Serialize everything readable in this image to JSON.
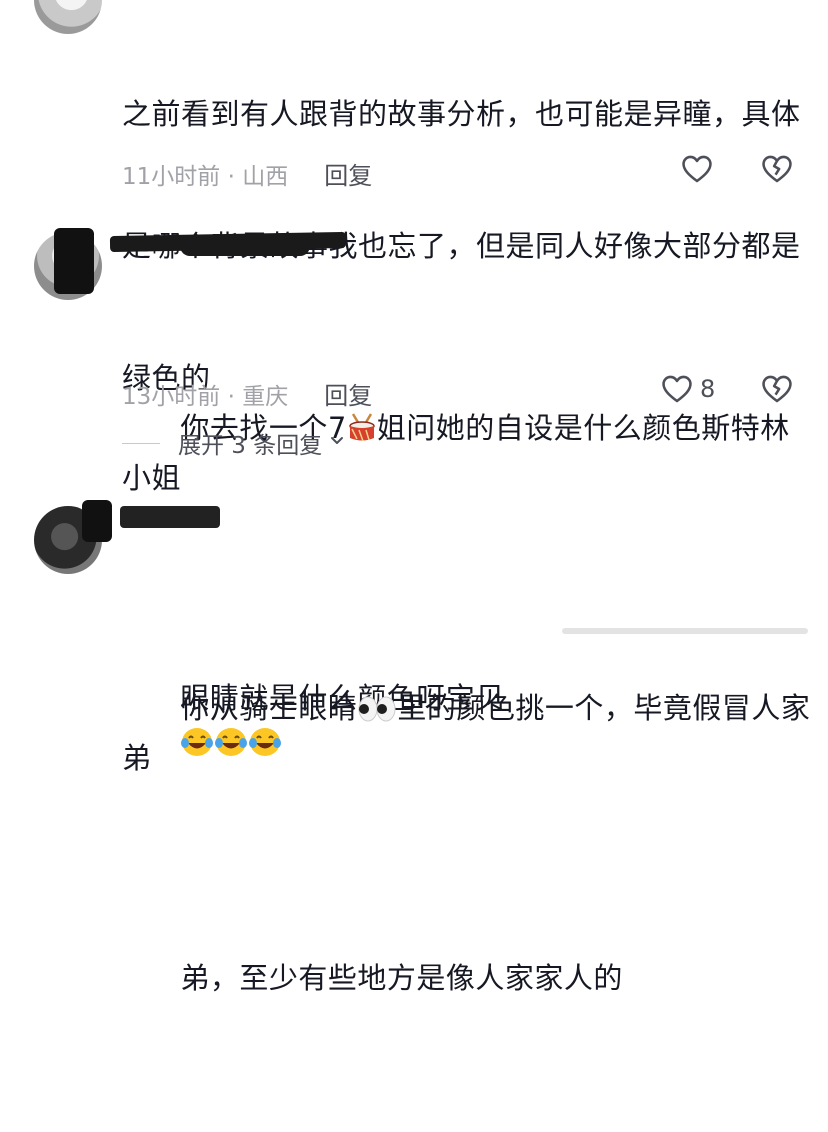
{
  "comments": [
    {
      "text": "之前看到有人跟背的故事分析，也可能是异瞳，具体是哪个背景故事我也忘了，但是同人好像大部分都是绿色的",
      "line1": "之前看到有人跟背的故事分析，也可能是异瞳，具体",
      "line2": "是哪个背景故事我也忘了，但是同人好像大部分都是",
      "line3": "绿色的",
      "time_location": "11小时前 · 山西",
      "reply_label": "回复",
      "like_count": ""
    },
    {
      "line1_a": "你去找一个7",
      "line1_emoji": "drum-emoji",
      "line1_b": "姐问她的自设是什么颜色斯特林小姐",
      "line2_a": "眼睛就是什么颜色呀宝贝",
      "line2_emoji": "tears-of-joy-emoji",
      "time_location": "13小时前 · 重庆",
      "reply_label": "回复",
      "like_count": "8",
      "expand_label": "展开 3 条回复"
    },
    {
      "line1_a": "你从骑士眼睛",
      "line1_emoji": "eyes-emoji",
      "line1_b": "里的颜色挑一个，毕竟假冒人家弟",
      "line2": "弟，至少有些地方是像人家家人的"
    }
  ],
  "icons": {
    "like": "heart-outline-icon",
    "dislike": "broken-heart-icon",
    "expand": "chevron-down-icon"
  },
  "colors": {
    "text": "#161823",
    "meta": "#a1a2a7",
    "action": "#4d4f59"
  }
}
